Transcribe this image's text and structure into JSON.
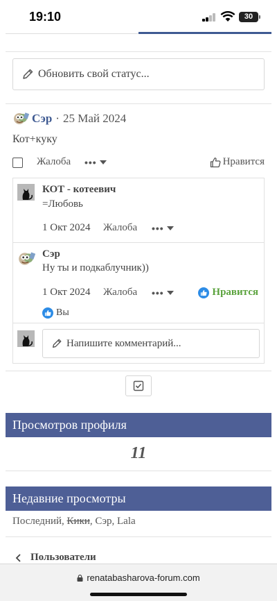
{
  "status_bar": {
    "time": "19:10",
    "battery": "30"
  },
  "status_update": {
    "placeholder": "Обновить свой статус..."
  },
  "post": {
    "author": "Сэр",
    "separator": "·",
    "date": "25 Май 2024",
    "text": "Кот+куку",
    "report_label": "Жалоба",
    "more_label": "•••",
    "like_label": "Нравится"
  },
  "comments": [
    {
      "name": "КОТ - котеевич",
      "text": "=Любовь",
      "date": "1 Окт 2024",
      "report_label": "Жалоба",
      "more_label": "•••"
    },
    {
      "name": "Сэр",
      "text": "Ну ты и подкаблучник))",
      "date": "1 Окт 2024",
      "report_label": "Жалоба",
      "more_label": "•••",
      "like_label": "Нравится",
      "liked_by": "Вы"
    }
  ],
  "comment_input": {
    "placeholder": "Напишите комментарий..."
  },
  "profile_views": {
    "title": "Просмотров профиля",
    "count": "11"
  },
  "recent_views": {
    "title": "Недавние просмотры",
    "prefix": "Последний,",
    "struck_name": "Кики",
    "rest": ", Сэр, Lala"
  },
  "back_link": {
    "label": "Пользователи"
  },
  "browser": {
    "url": "renatabasharova-forum.com"
  },
  "colors": {
    "brand": "#4e5f96",
    "link": "#3f5a92",
    "liked": "#5aa23c",
    "like_icon": "#2d8ce6"
  }
}
